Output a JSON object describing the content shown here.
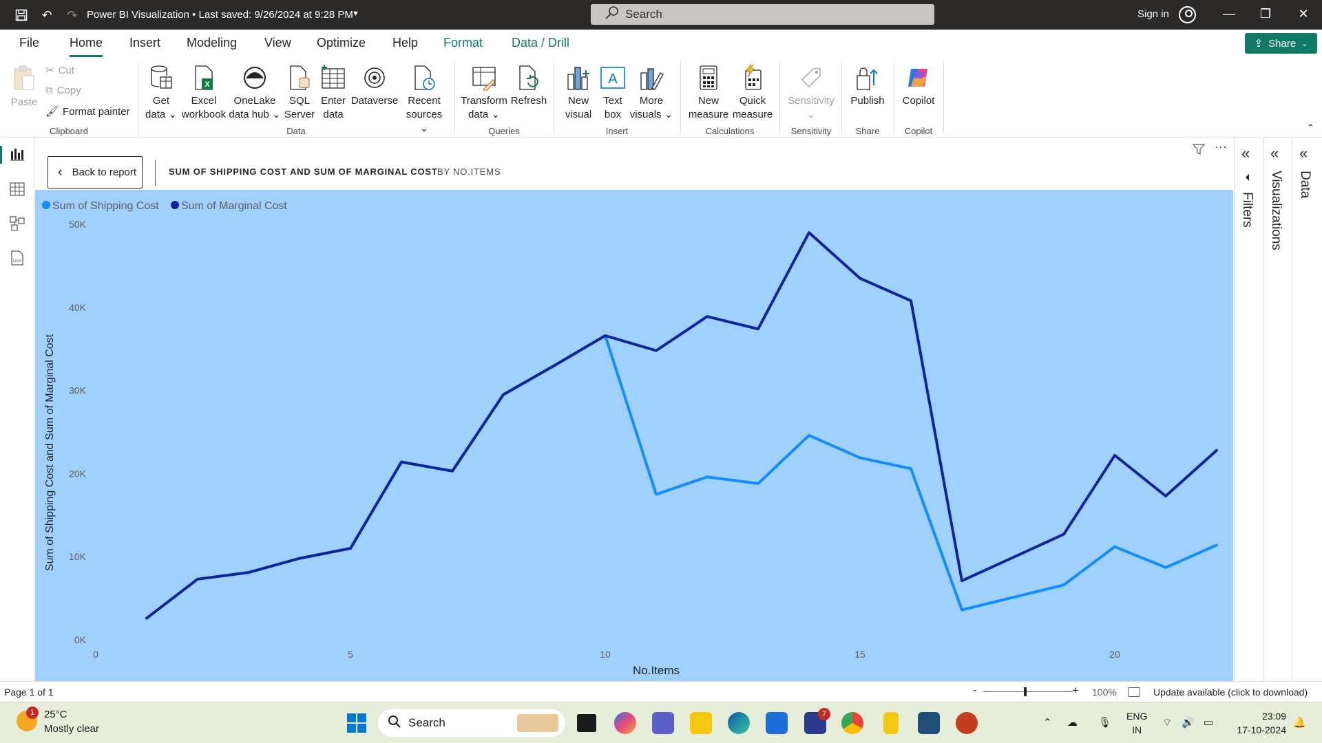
{
  "titlebar": {
    "title": "Power BI Visualization • Last saved: 9/26/2024 at 9:28 PM",
    "search_placeholder": "Search",
    "signin": "Sign in"
  },
  "menu": {
    "tabs": [
      "File",
      "Home",
      "Insert",
      "Modeling",
      "View",
      "Optimize",
      "Help",
      "Format",
      "Data / Drill"
    ],
    "active": "Home",
    "share": "Share"
  },
  "ribbon": {
    "clipboard": {
      "paste": "Paste",
      "cut": "Cut",
      "copy": "Copy",
      "format_painter": "Format painter",
      "label": "Clipboard"
    },
    "data": {
      "get_data": [
        "Get",
        "data"
      ],
      "excel": [
        "Excel",
        "workbook"
      ],
      "onelake": [
        "OneLake",
        "data hub"
      ],
      "sql": [
        "SQL",
        "Server"
      ],
      "enter": [
        "Enter",
        "data"
      ],
      "dataverse": "Dataverse",
      "recent": [
        "Recent",
        "sources"
      ],
      "label": "Data"
    },
    "queries": {
      "transform": [
        "Transform",
        "data"
      ],
      "refresh": "Refresh",
      "label": "Queries"
    },
    "insert": {
      "new_visual": [
        "New",
        "visual"
      ],
      "text_box": [
        "Text",
        "box"
      ],
      "more_visuals": [
        "More",
        "visuals"
      ],
      "label": "Insert"
    },
    "calculations": {
      "new_measure": [
        "New",
        "measure"
      ],
      "quick_measure": [
        "Quick",
        "measure"
      ],
      "label": "Calculations"
    },
    "sensitivity": {
      "btn": "Sensitivity",
      "label": "Sensitivity"
    },
    "share": {
      "publish": "Publish",
      "label": "Share"
    },
    "copilot": {
      "btn": "Copilot",
      "label": "Copilot"
    }
  },
  "focus": {
    "back": "Back to report",
    "title": "SUM OF SHIPPING COST AND SUM OF MARGINAL COST",
    "subtitle": "BY NO.ITEMS"
  },
  "panes": {
    "filters": "Filters",
    "visualizations": "Visualizations",
    "data": "Data"
  },
  "status": {
    "page": "Page 1 of 1",
    "zoom_minus": "-",
    "zoom_plus": "+",
    "zoom": "100%",
    "update": "Update available (click to download)"
  },
  "taskbar": {
    "temp": "25°C",
    "weather": "Mostly clear",
    "weather_badge": "1",
    "search": "Search",
    "lang1": "ENG",
    "lang2": "IN",
    "time": "23:09",
    "date": "17-10-2024",
    "mail_badge": "7"
  },
  "colors": {
    "accent": "#117865",
    "plot_bg": "#a0d0fd",
    "shipping": "#118dff",
    "marginal": "#12239e"
  },
  "chart_data": {
    "type": "line",
    "title": "SUM OF SHIPPING COST AND SUM OF MARGINAL COST BY NO.ITEMS",
    "xlabel": "No.Items",
    "ylabel": "Sum of Shipping Cost and Sum of Marginal Cost",
    "xlim": [
      0,
      22
    ],
    "ylim": [
      0,
      50000
    ],
    "x_ticks": [
      0,
      5,
      10,
      15,
      20
    ],
    "y_ticks": [
      0,
      10000,
      20000,
      30000,
      40000,
      50000
    ],
    "y_tick_labels": [
      "0K",
      "10K",
      "20K",
      "30K",
      "40K",
      "50K"
    ],
    "legend": "top-left",
    "x": [
      1,
      2,
      3,
      4,
      5,
      6,
      7,
      8,
      9,
      10,
      11,
      12,
      13,
      14,
      15,
      16,
      17,
      18,
      19,
      20,
      21,
      22
    ],
    "series": [
      {
        "name": "Sum of Shipping Cost",
        "color": "#118dff",
        "values": [
          2600,
          7300,
          8100,
          9800,
          11000,
          21400,
          20300,
          29500,
          33000,
          36600,
          17500,
          19600,
          18800,
          24600,
          21900,
          20600,
          3600,
          5100,
          6600,
          11200,
          8700,
          11400
        ]
      },
      {
        "name": "Sum of Marginal Cost",
        "color": "#12239e",
        "values": [
          2600,
          7300,
          8100,
          9800,
          11000,
          21400,
          20300,
          29500,
          33000,
          36600,
          34800,
          38900,
          37400,
          49000,
          43500,
          40800,
          7100,
          9900,
          12700,
          22200,
          17300,
          22800
        ]
      }
    ]
  }
}
